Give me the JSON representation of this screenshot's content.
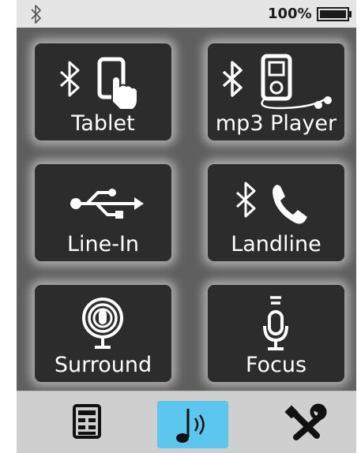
{
  "status": {
    "bluetooth_icon": "bluetooth-icon",
    "battery_text": "100%",
    "battery_level": 1.0,
    "battery_icon": "battery-icon"
  },
  "sources": [
    {
      "label": "Tablet",
      "icon": "bluetooth-tablet-icon"
    },
    {
      "label": "mp3 Player",
      "icon": "bluetooth-mp3-player-icon"
    },
    {
      "label": "Line-In",
      "icon": "usb-icon"
    },
    {
      "label": "Landline",
      "icon": "bluetooth-phone-icon"
    },
    {
      "label": "Surround",
      "icon": "surround-microphone-icon"
    },
    {
      "label": "Focus",
      "icon": "focus-microphone-icon"
    }
  ],
  "tabs": [
    {
      "icon": "keypad-icon",
      "active": false
    },
    {
      "icon": "music-note-icon",
      "active": true
    },
    {
      "icon": "tools-icon",
      "active": false
    }
  ],
  "colors": {
    "panel": "#5f5f5f",
    "button": "#2c2c2c",
    "active_tab": "#5bc7ef",
    "tabbar": "#cfcfcf",
    "statusbar": "#e5e5e5"
  }
}
